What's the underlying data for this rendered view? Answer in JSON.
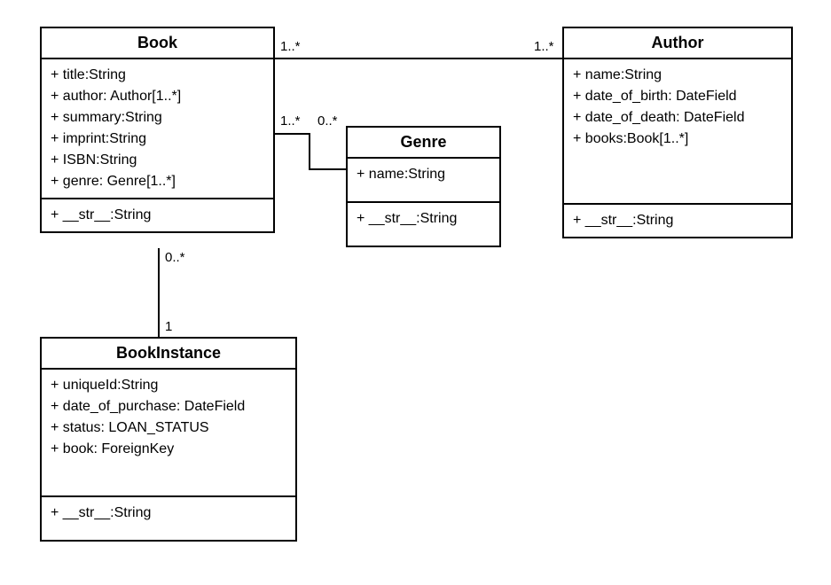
{
  "classes": {
    "book": {
      "title": "Book",
      "attr0": "+ title:String",
      "attr1": "+ author: Author[1..*]",
      "attr2": "+ summary:String",
      "attr3": "+ imprint:String",
      "attr4": "+ ISBN:String",
      "attr5": "+ genre: Genre[1..*]",
      "method0": "+ __str__:String"
    },
    "author": {
      "title": "Author",
      "attr0": "+ name:String",
      "attr1": "+ date_of_birth: DateField",
      "attr2": "+ date_of_death: DateField",
      "attr3": "+ books:Book[1..*]",
      "method0": "+ __str__:String"
    },
    "genre": {
      "title": "Genre",
      "attr0": "+ name:String",
      "method0": "+ __str__:String"
    },
    "bookinstance": {
      "title": "BookInstance",
      "attr0": "+ uniqueId:String",
      "attr1": "+ date_of_purchase: DateField",
      "attr2": "+ status: LOAN_STATUS",
      "attr3": "+ book: ForeignKey",
      "method0": "+ __str__:String"
    }
  },
  "multiplicities": {
    "book_author_left": "1..*",
    "book_author_right": "1..*",
    "book_genre_left": "1..*",
    "book_genre_right": "0..*",
    "book_instance_top": "0..*",
    "book_instance_bottom": "1"
  }
}
